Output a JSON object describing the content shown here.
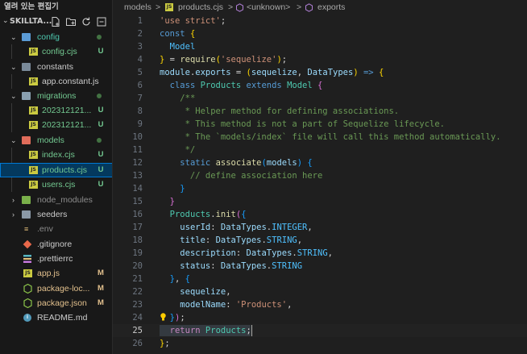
{
  "sidebar": {
    "open_editors_label": "열려 있는 편집기",
    "project_name": "SKILLTA...",
    "tree": [
      {
        "label": "config",
        "kind": "folder",
        "status": "dot",
        "color": "#4ec9b0"
      },
      {
        "label": "config.cjs",
        "kind": "js",
        "status": "U",
        "color": "#73c991"
      },
      {
        "label": "constants",
        "kind": "folder",
        "status": "",
        "color": "#cccccc"
      },
      {
        "label": "app.constant.js",
        "kind": "js",
        "status": "",
        "color": "#cccccc"
      },
      {
        "label": "migrations",
        "kind": "folder",
        "status": "dot",
        "color": "#73c991"
      },
      {
        "label": "202312121...",
        "kind": "js",
        "status": "U",
        "color": "#73c991"
      },
      {
        "label": "202312121...",
        "kind": "js",
        "status": "U",
        "color": "#73c991"
      },
      {
        "label": "models",
        "kind": "folder",
        "status": "dot",
        "color": "#73c991"
      },
      {
        "label": "index.cjs",
        "kind": "js",
        "status": "U",
        "color": "#73c991"
      },
      {
        "label": "products.cjs",
        "kind": "js",
        "status": "U",
        "color": "#73c991"
      },
      {
        "label": "users.cjs",
        "kind": "js",
        "status": "U",
        "color": "#73c991"
      },
      {
        "label": "node_modules",
        "kind": "folder",
        "status": "",
        "color": "#8c8c8c"
      },
      {
        "label": "seeders",
        "kind": "folder",
        "status": "",
        "color": "#cccccc"
      },
      {
        "label": ".env",
        "kind": "env",
        "status": "",
        "color": "#8c8c8c"
      },
      {
        "label": ".gitignore",
        "kind": "git",
        "status": "",
        "color": "#cccccc"
      },
      {
        "label": ".prettierrc",
        "kind": "prettier",
        "status": "",
        "color": "#cccccc"
      },
      {
        "label": "app.js",
        "kind": "js",
        "status": "M",
        "color": "#e2c08d"
      },
      {
        "label": "package-loc...",
        "kind": "pkg",
        "status": "M",
        "color": "#e2c08d"
      },
      {
        "label": "package.json",
        "kind": "pkg",
        "status": "M",
        "color": "#e2c08d"
      },
      {
        "label": "README.md",
        "kind": "info",
        "status": "",
        "color": "#cccccc"
      }
    ]
  },
  "breadcrumb": {
    "folder": "models",
    "sep": ">",
    "file": "products.cjs",
    "symbol1": "<unknown>",
    "symbol2": "exports"
  },
  "editor": {
    "active_line": 25,
    "line_numbers": [
      "1",
      "2",
      "3",
      "4",
      "5",
      "6",
      "7",
      "8",
      "9",
      "10",
      "11",
      "12",
      "13",
      "14",
      "15",
      "16",
      "17",
      "18",
      "19",
      "20",
      "21",
      "22",
      "23",
      "24",
      "25",
      "26"
    ]
  }
}
